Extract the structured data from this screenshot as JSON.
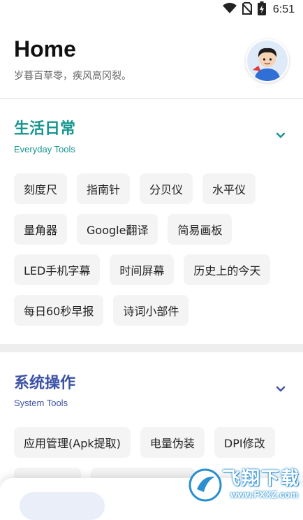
{
  "status_bar": {
    "time": "6:51",
    "icons": [
      "wifi-icon",
      "no-sim-icon",
      "battery-charging-icon"
    ]
  },
  "header": {
    "title": "Home",
    "subtitle": "岁暮百草零，疾风高冈裂。",
    "avatar_icon": "avatar-cartoon-boy"
  },
  "sections": [
    {
      "title": "生活日常",
      "subtitle": "Everyday Tools",
      "color": "#16968f",
      "items": [
        "刻度尺",
        "指南针",
        "分贝仪",
        "水平仪",
        "量角器",
        "Google翻译",
        "简易画板",
        "LED手机字幕",
        "时间屏幕",
        "历史上的今天",
        "每日60秒早报",
        "诗词小部件"
      ]
    },
    {
      "title": "系统操作",
      "subtitle": "System Tools",
      "color": "#3d52a6",
      "items": [
        "应用管理(Apk提取)",
        "电量伪装",
        "DPI修改",
        "",
        ""
      ]
    }
  ],
  "colors": {
    "chip_background": "#f4f4f4",
    "divider": "#eeeeee",
    "watermark": "#2a8fd0"
  },
  "watermark": {
    "line1": "飞翔下载",
    "line2": "www.FXXZ.com"
  }
}
